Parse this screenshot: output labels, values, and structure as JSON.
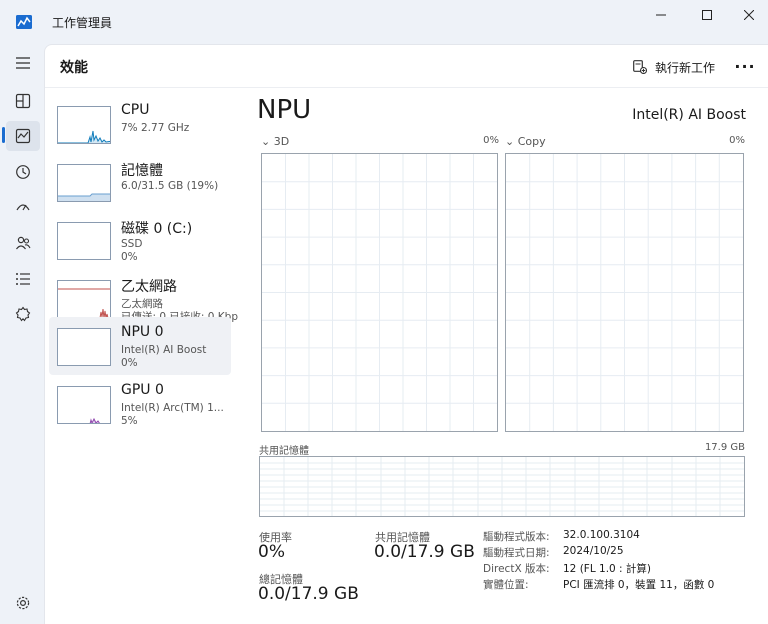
{
  "window": {
    "title": "工作管理員"
  },
  "nav": {
    "items": [
      "hamburger-menu-icon",
      "processes-icon",
      "performance-icon",
      "app-history-icon",
      "startup-apps-icon",
      "users-icon",
      "details-icon",
      "services-icon"
    ],
    "settings": "settings-icon"
  },
  "header": {
    "title": "效能",
    "run_task_label": "執行新工作",
    "more_label": "···"
  },
  "resources": [
    {
      "name": "CPU",
      "sub1": "7%  2.77 GHz",
      "sub2": ""
    },
    {
      "name": "記憶體",
      "sub1": "6.0/31.5 GB (19%)",
      "sub2": ""
    },
    {
      "name": "磁碟 0 (C:)",
      "sub1": "SSD",
      "sub2": "0%"
    },
    {
      "name": "乙太網路",
      "sub1": "乙太網路",
      "sub2": "已傳送: 0 已接收: 0 Kbp"
    },
    {
      "name": "NPU 0",
      "sub1": "Intel(R) AI Boost",
      "sub2": "0%"
    },
    {
      "name": "GPU 0",
      "sub1": "Intel(R) Arc(TM) 1...",
      "sub2": "5%"
    }
  ],
  "detail": {
    "title": "NPU",
    "device": "Intel(R) AI Boost",
    "graphs": [
      {
        "label": "3D",
        "pct": "0%"
      },
      {
        "label": "Copy",
        "pct": "0%"
      }
    ],
    "shared_memory": {
      "label": "共用記憶體",
      "max": "17.9 GB"
    },
    "stats": {
      "usage_label": "使用率",
      "usage_value": "0%",
      "shared_label": "共用記憶體",
      "shared_value": "0.0/17.9 GB",
      "total_label": "總記憶體",
      "total_value": "0.0/17.9 GB"
    },
    "info": [
      {
        "key": "驅動程式版本:",
        "value": "32.0.100.3104"
      },
      {
        "key": "驅動程式日期:",
        "value": "2024/10/25"
      },
      {
        "key": "DirectX 版本:",
        "value": "12 (FL 1.0 : 計算)"
      },
      {
        "key": "實體位置:",
        "value": "PCI 匯流排 0，裝置 11，函數 0"
      }
    ]
  },
  "colors": {
    "accent": "#1a6cd0",
    "cpu": "#117dbb",
    "memory": "#8b12ae",
    "ethernet": "#a74f01",
    "gpu": "#8e44ad"
  }
}
